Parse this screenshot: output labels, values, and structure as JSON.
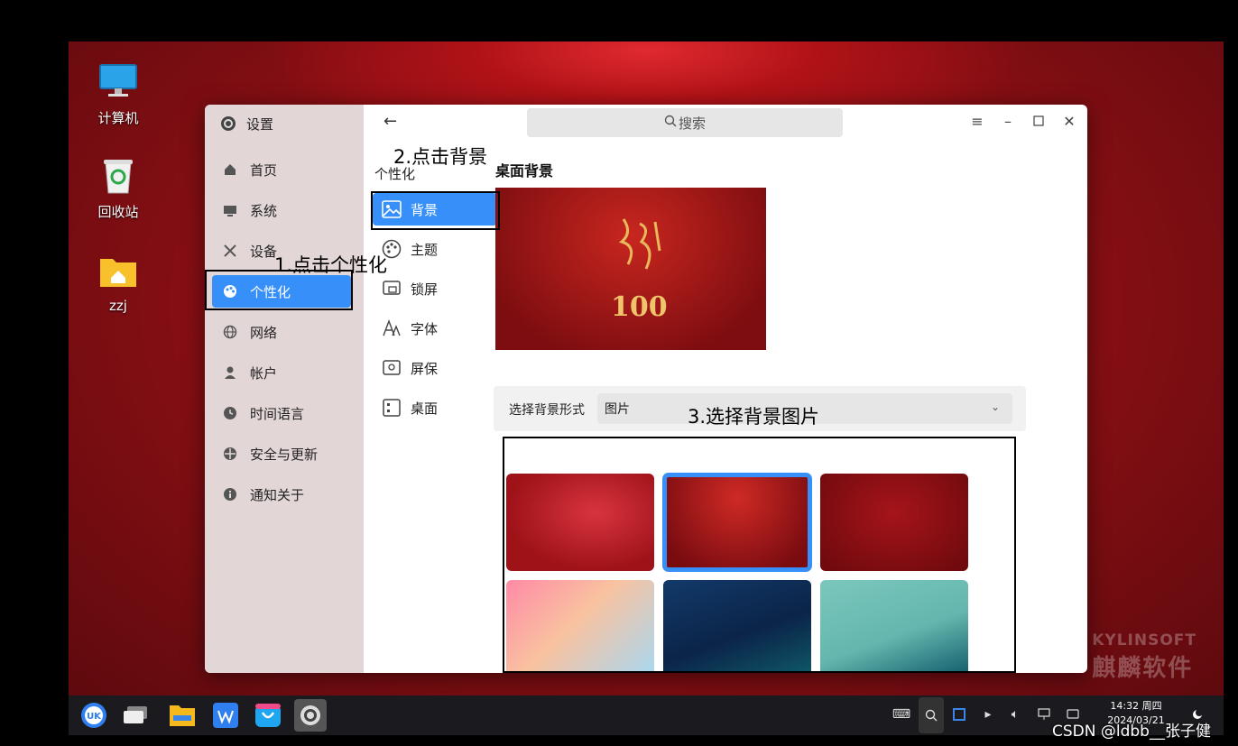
{
  "desktop": {
    "icons": [
      {
        "label": "计算机",
        "icon": "computer-icon"
      },
      {
        "label": "回收站",
        "icon": "trash-icon"
      },
      {
        "label": "zzj",
        "icon": "home-folder-icon"
      }
    ],
    "watermark_en": "KYLINSOFT",
    "watermark_cn": "麒麟软件"
  },
  "settings": {
    "title": "设置",
    "sidebar_items": [
      {
        "label": "首页",
        "icon": "home-icon"
      },
      {
        "label": "系统",
        "icon": "monitor-icon"
      },
      {
        "label": "设备",
        "icon": "tools-icon"
      },
      {
        "label": "个性化",
        "icon": "palette-icon",
        "active": true
      },
      {
        "label": "网络",
        "icon": "globe-icon"
      },
      {
        "label": "帐户",
        "icon": "user-icon"
      },
      {
        "label": "时间语言",
        "icon": "clock-icon"
      },
      {
        "label": "安全与更新",
        "icon": "shield-icon"
      },
      {
        "label": "通知关于",
        "icon": "info-icon"
      }
    ],
    "subpanel_title": "个性化",
    "subpanel_items": [
      {
        "label": "背景",
        "icon": "image-icon",
        "active": true
      },
      {
        "label": "主题",
        "icon": "theme-icon"
      },
      {
        "label": "锁屏",
        "icon": "lockscreen-icon"
      },
      {
        "label": "字体",
        "icon": "font-icon"
      },
      {
        "label": "屏保",
        "icon": "screensaver-icon"
      },
      {
        "label": "桌面",
        "icon": "desktop-grid-icon"
      }
    ],
    "search_placeholder": "搜索",
    "section_title": "桌面背景",
    "bg_form_label": "选择背景形式",
    "bg_form_value": "图片",
    "preview_text": "100",
    "wallpaper_count": 6,
    "selected_wallpaper_index": 1
  },
  "annotations": {
    "step1": "1.点击个性化",
    "step2": "2.点击背景",
    "step3": "3.选择背景图片"
  },
  "taskbar": {
    "apps": [
      "kylin-start-icon",
      "multitask-view-icon",
      "file-manager-icon",
      "wps-icon",
      "software-store-icon",
      "settings-icon"
    ],
    "time": "14:32 周四",
    "date": "2024/03/21"
  },
  "watermark_csdn": "CSDN @ldbb__张子健",
  "colors": {
    "accent": "#3790fa",
    "sidebar_bg": "#e3d6d7",
    "desktop_red": "#8a0f14"
  }
}
